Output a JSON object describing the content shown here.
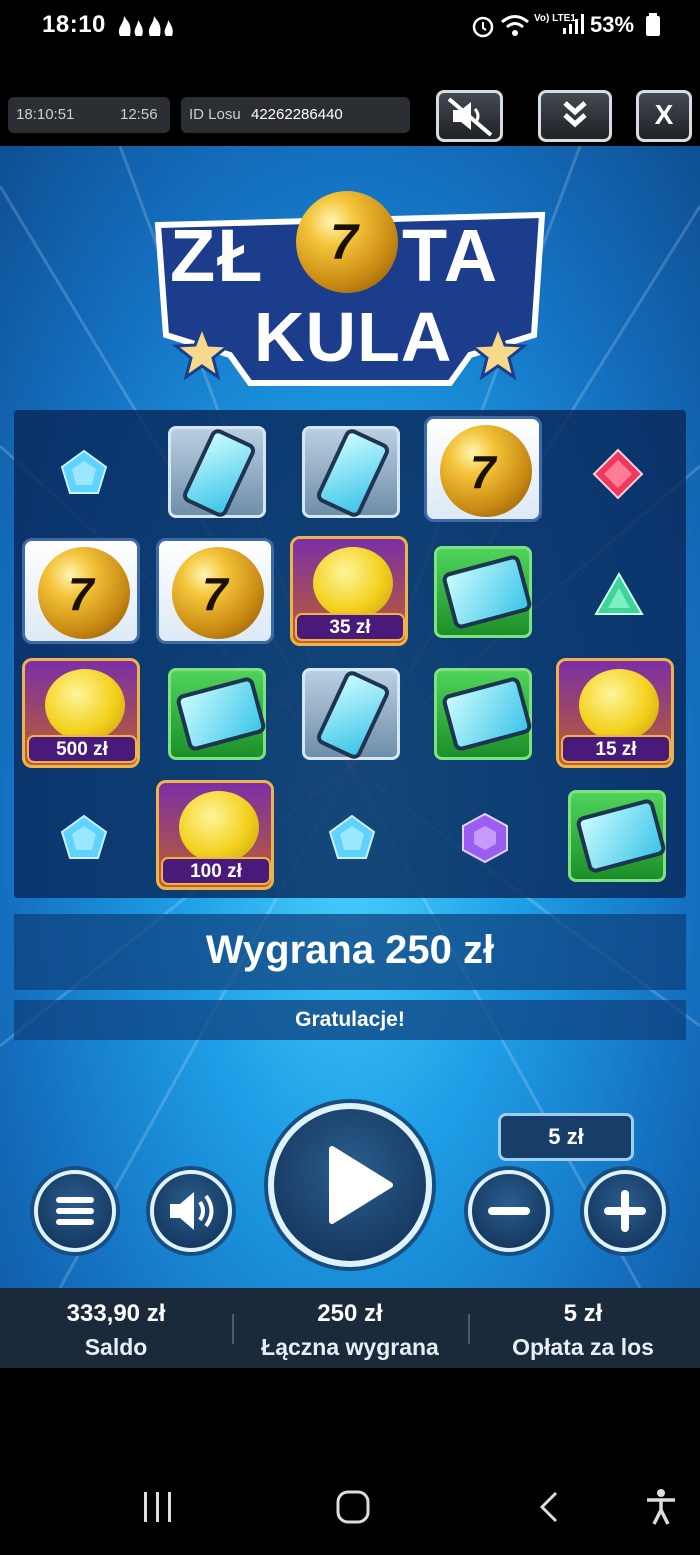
{
  "status_bar": {
    "time": "18:10",
    "battery": "53%",
    "network": "Vo) LTE1"
  },
  "top_bar": {
    "clock": "18:10:51",
    "elapsed": "12:56",
    "ticket_label": "ID Losu",
    "ticket_id": "42262286440",
    "close_label": "X"
  },
  "logo": {
    "line1": "ZŁ",
    "line1b": "TA",
    "line2": "KULA"
  },
  "grid": {
    "prizes": {
      "r2c3": "35 zł",
      "r3c1": "500 zł",
      "r3c5": "15 zł",
      "r4c2": "100 zł"
    },
    "ball_digit": "7"
  },
  "result": {
    "win": "Wygrana 250 zł",
    "message": "Gratulacje!"
  },
  "controls": {
    "stake": "5 zł"
  },
  "info": {
    "balance_value": "333,90 zł",
    "balance_label": "Saldo",
    "total_win_value": "250 zł",
    "total_win_label": "Łączna wygrana",
    "fee_value": "5 zł",
    "fee_label": "Opłata za los"
  },
  "colors": {
    "accent": "#1e9ee6",
    "prize_bg": "#4a1a7a",
    "gold": "#f4c43a"
  }
}
